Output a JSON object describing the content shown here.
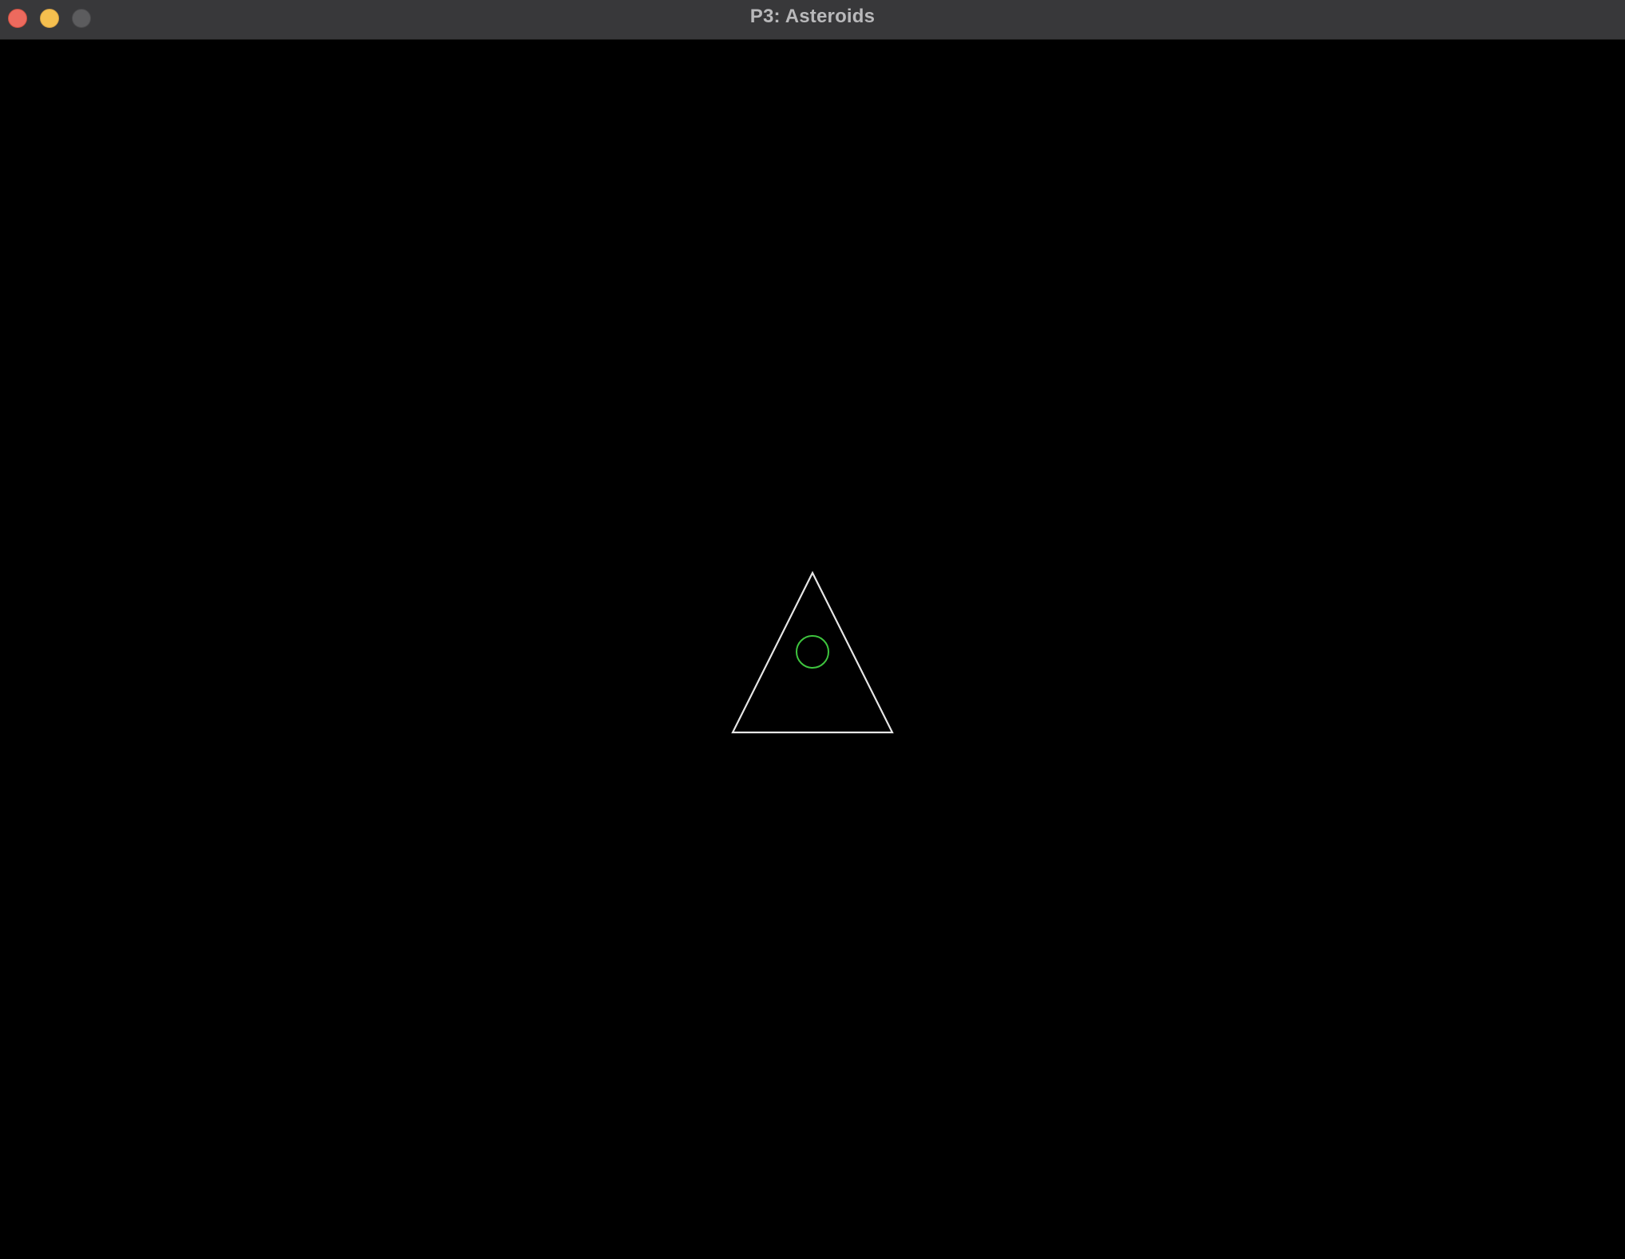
{
  "window": {
    "title": "P3: Asteroids",
    "controls": [
      {
        "name": "close",
        "color": "#ed6a5e",
        "border": "#d05142"
      },
      {
        "name": "minimize",
        "color": "#f5bf4f",
        "border": "#d6a243"
      },
      {
        "name": "zoom",
        "color": "#5c5c5e",
        "border": "#4a4a4c"
      }
    ]
  },
  "game": {
    "background": "#000000",
    "ship": {
      "shape": "triangle",
      "stroke": "#e6e6e6",
      "facing": "up"
    },
    "shield": {
      "shape": "circle",
      "stroke": "#3ec43e"
    }
  }
}
